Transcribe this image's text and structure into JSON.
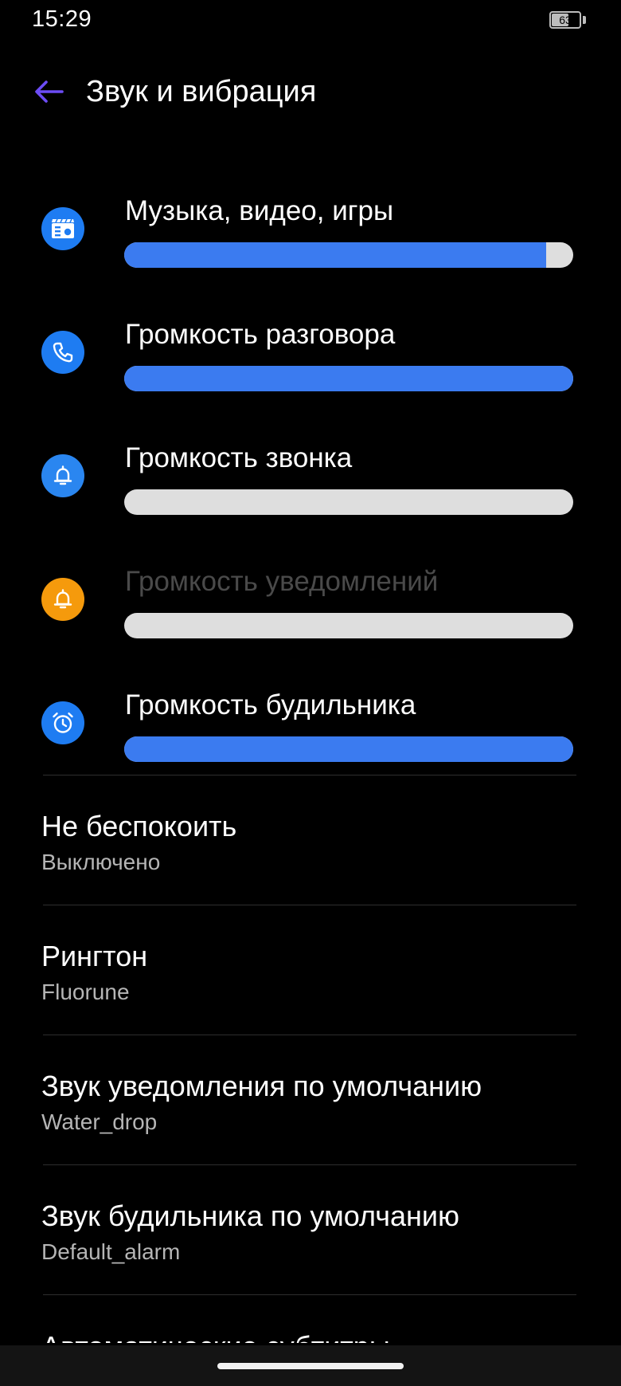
{
  "status_bar": {
    "time": "15:29",
    "battery": "63",
    "battery_level": 0.63
  },
  "header": {
    "title": "Звук и вибрация",
    "back_icon": "arrow-left-icon"
  },
  "colors": {
    "accent": "#3b7bf0",
    "back_arrow": "#6c4cf5",
    "icon_blue": "#1e7cf2",
    "icon_orange": "#f59a0c",
    "track": "#dedede"
  },
  "volumes": [
    {
      "label": "Музыка, видео, игры",
      "icon": "media-icon",
      "level": 0.94,
      "disabled": false
    },
    {
      "label": "Громкость разговора",
      "icon": "phone-icon",
      "level": 1.0,
      "disabled": false
    },
    {
      "label": "Громкость звонка",
      "icon": "bell-icon",
      "level": 0.0,
      "disabled": false
    },
    {
      "label": "Громкость уведомлений",
      "icon": "bell-icon",
      "level": 0.0,
      "disabled": true
    },
    {
      "label": "Громкость будильника",
      "icon": "alarm-clock-icon",
      "level": 1.0,
      "disabled": false
    }
  ],
  "settings": [
    {
      "title": "Не беспокоить",
      "value": "Выключено"
    },
    {
      "title": "Рингтон",
      "value": "Fluorune"
    },
    {
      "title": "Звук уведомления по умолчанию",
      "value": "Water_drop"
    },
    {
      "title": "Звук будильника по умолчанию",
      "value": "Default_alarm"
    }
  ],
  "cut_off_item": "Автоматические субтитры"
}
